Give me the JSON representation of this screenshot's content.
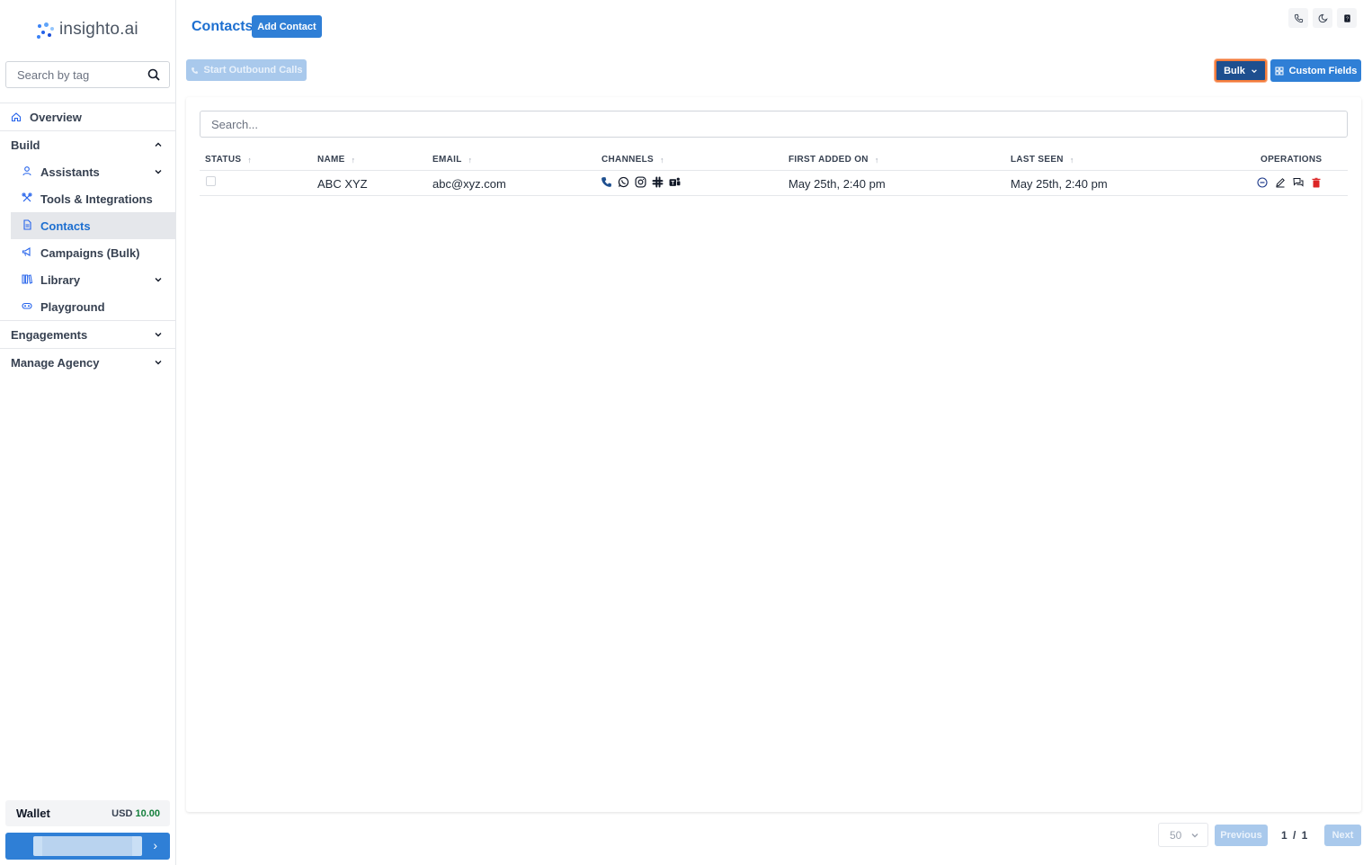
{
  "brand": {
    "name": "insighto.ai",
    "accent": "#2f7fd6"
  },
  "sidebar": {
    "search_placeholder": "Search by tag",
    "overview": "Overview",
    "build": {
      "label": "Build",
      "items": [
        {
          "label": "Assistants",
          "icon": "person-icon",
          "expandable": true
        },
        {
          "label": "Tools & Integrations",
          "icon": "tools-icon"
        },
        {
          "label": "Contacts",
          "icon": "document-icon",
          "active": true
        },
        {
          "label": "Campaigns (Bulk)",
          "icon": "megaphone-icon"
        },
        {
          "label": "Library",
          "icon": "library-icon",
          "expandable": true
        },
        {
          "label": "Playground",
          "icon": "gamepad-icon"
        }
      ]
    },
    "engagements": "Engagements",
    "manage_agency": "Manage Agency",
    "wallet": {
      "label": "Wallet",
      "currency": "USD",
      "amount": "10.00"
    }
  },
  "header": {
    "title": "Contacts",
    "add_button": "Add Contact",
    "outbound_button": "Start Outbound Calls",
    "bulk_button": "Bulk",
    "custom_fields_button": "Custom Fields"
  },
  "table": {
    "search_placeholder": "Search...",
    "columns": [
      "STATUS",
      "NAME",
      "EMAIL",
      "CHANNELS",
      "FIRST ADDED ON",
      "LAST SEEN",
      "OPERATIONS"
    ],
    "rows": [
      {
        "name": "ABC XYZ",
        "email": "abc@xyz.com",
        "channels": [
          "phone-icon",
          "whatsapp-icon",
          "instagram-icon",
          "slack-icon",
          "teams-icon"
        ],
        "first_added_on": "May 25th, 2:40 pm",
        "last_seen": "May 25th, 2:40 pm",
        "operations": [
          "minus-circle-icon",
          "edit-icon",
          "chat-icon",
          "delete-icon"
        ]
      }
    ]
  },
  "pagination": {
    "page_size": "50",
    "previous": "Previous",
    "page_info": "1 / 1",
    "next": "Next"
  }
}
